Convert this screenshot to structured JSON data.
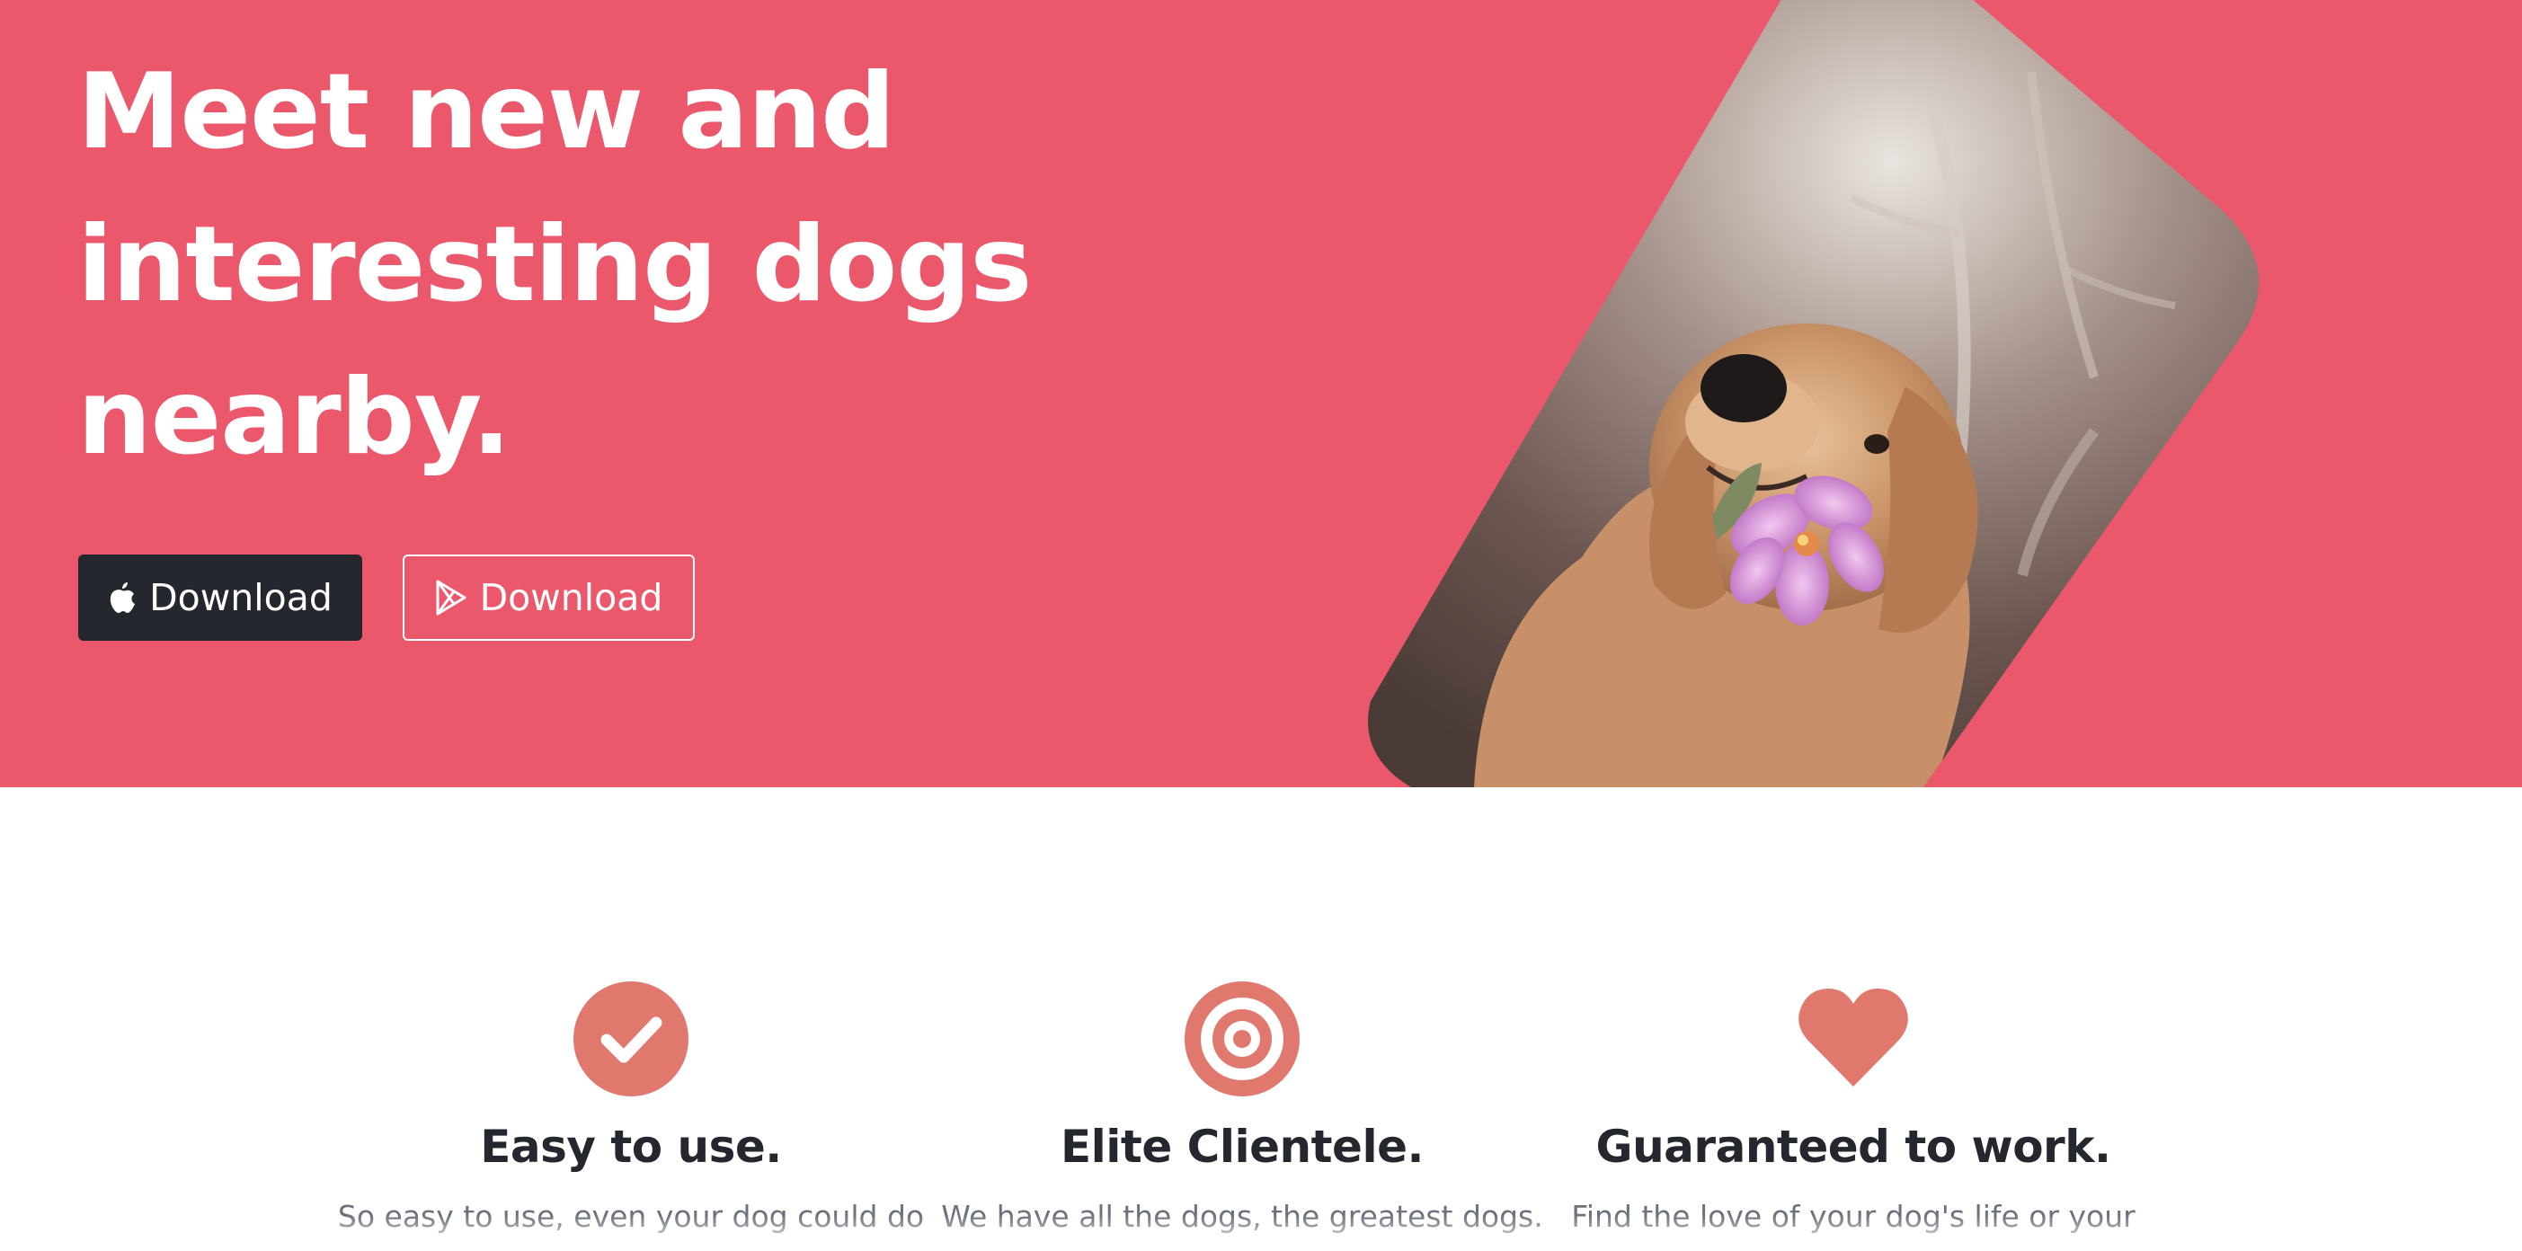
{
  "hero": {
    "background": "#ec586b",
    "title_lines": [
      "Meet new and",
      "interesting dogs",
      "nearby."
    ],
    "buttons": {
      "apple_label": "Download",
      "play_label": "Download"
    },
    "photo_description_icon": "dog-with-flower-photo"
  },
  "features": [
    {
      "icon": "check-circle-icon",
      "title": "Easy to use.",
      "text": "So easy to use, even your dog could do"
    },
    {
      "icon": "bullseye-icon",
      "title": "Elite Clientele.",
      "text": "We have all the dogs, the greatest dogs."
    },
    {
      "icon": "heart-icon",
      "title": "Guaranteed to work.",
      "text": "Find the love of your dog's life or your"
    }
  ],
  "colors": {
    "accent": "#ec586b",
    "icon": "#e0786e",
    "dark": "#24272d",
    "muted": "#6c727b"
  }
}
